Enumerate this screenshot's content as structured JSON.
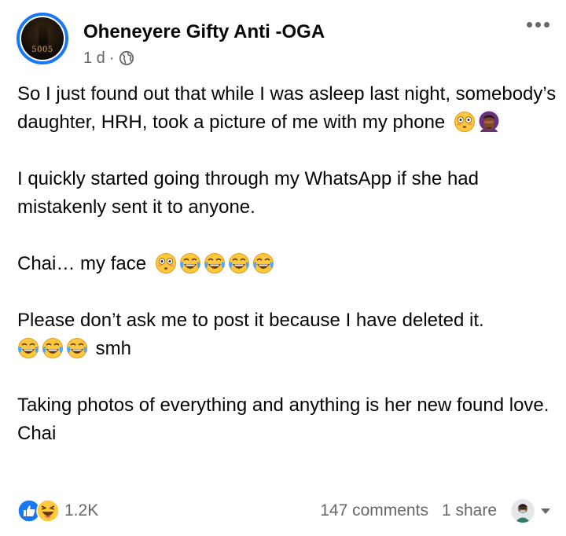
{
  "post": {
    "author": "Oheneyere Gifty Anti -OGA",
    "avatar_badge_text": "5005",
    "time": "1 d",
    "separator": "·",
    "privacy_icon": "globe-icon",
    "more_icon": "more-horizontal-icon",
    "paragraphs": [
      {
        "text": "So I just found out that while I was asleep last night, somebody’s daughter, HRH, took a picture of me with my phone",
        "emojis": [
          "flushed-face-emoji",
          "facepalm-woman-emoji"
        ]
      },
      {
        "text": "I quickly started going through my WhatsApp if she had mistakenly sent it to anyone.",
        "emojis": []
      },
      {
        "text": "Chai… my face",
        "emojis": [
          "flushed-face-emoji",
          "tears-of-joy-emoji",
          "tears-of-joy-emoji",
          "tears-of-joy-emoji",
          "tears-of-joy-emoji"
        ]
      },
      {
        "text": "Please don’t ask me to post it because I have deleted it.",
        "emojis": []
      },
      {
        "text": "smh",
        "emojis_before": [
          "tears-of-joy-emoji",
          "tears-of-joy-emoji",
          "tears-of-joy-emoji"
        ]
      },
      {
        "text": "Taking photos of everything and anything is her new found love.  Chai",
        "emojis": []
      }
    ]
  },
  "footer": {
    "reaction_icons": [
      "like-icon",
      "haha-icon"
    ],
    "reaction_count": "1.2K",
    "comments": "147 comments",
    "shares": "1 share",
    "reactor_icon": "reactor-avatar",
    "dropdown_icon": "caret-down-icon"
  },
  "colors": {
    "accent": "#1877f2",
    "text": "#050505",
    "secondary_text": "#65676b",
    "emoji_yellow": "#ffc83d"
  }
}
